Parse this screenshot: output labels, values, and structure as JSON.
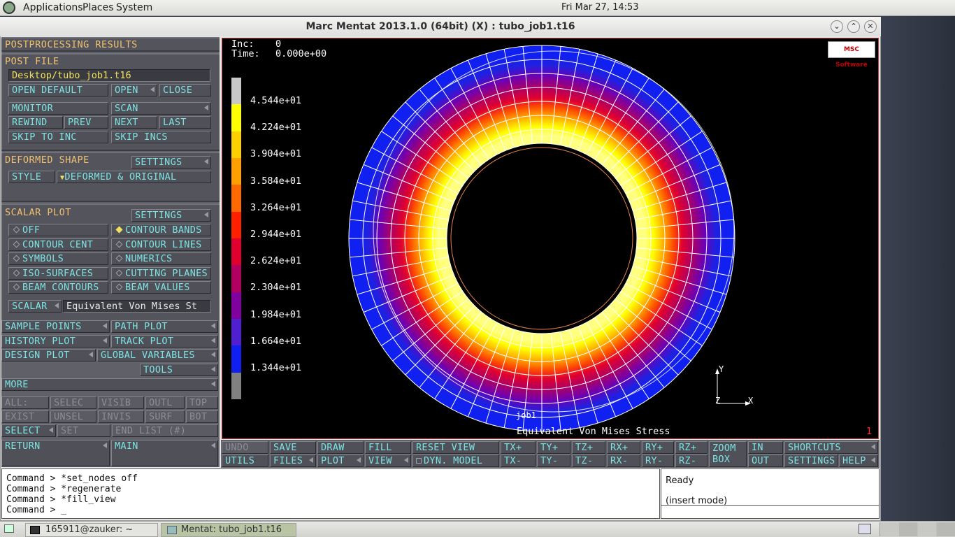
{
  "top_panel": {
    "menus": [
      "Applications",
      "Places",
      "System"
    ],
    "clock": "Fri Mar 27, 14:53"
  },
  "window": {
    "title": "Marc Mentat 2013.1.0 (64bit) (X) : tubo_job1.t16"
  },
  "left_panel": {
    "header": "POSTPROCESSING RESULTS",
    "post_file": {
      "label": "POST FILE",
      "path": "Desktop/tubo_job1.t16",
      "open_default": "OPEN DEFAULT",
      "open": "OPEN",
      "close": "CLOSE"
    },
    "nav": {
      "monitor": "MONITOR",
      "scan": "SCAN",
      "rewind": "REWIND",
      "prev": "PREV",
      "next": "NEXT",
      "last": "LAST",
      "skip_to_inc": "SKIP TO INC",
      "skip_incs": "SKIP INCS"
    },
    "deformed": {
      "label": "DEFORMED SHAPE",
      "settings": "SETTINGS",
      "style": "STYLE",
      "style_value": "DEFORMED & ORIGINAL"
    },
    "scalar": {
      "label": "SCALAR PLOT",
      "settings": "SETTINGS",
      "options": [
        "OFF",
        "CONTOUR BANDS",
        "CONTOUR CENT",
        "CONTOUR LINES",
        "SYMBOLS",
        "NUMERICS",
        "ISO-SURFACES",
        "CUTTING PLANES",
        "BEAM CONTOURS",
        "BEAM VALUES"
      ],
      "scalar_btn": "SCALAR",
      "scalar_value": "Equivalent Von Mises St"
    },
    "plots": {
      "sample_points": "SAMPLE POINTS",
      "path_plot": "PATH PLOT",
      "history_plot": "HISTORY PLOT",
      "track_plot": "TRACK PLOT",
      "design_plot": "DESIGN PLOT",
      "global_variables": "GLOBAL VARIABLES",
      "tools": "TOOLS",
      "more": "MORE"
    },
    "select_bar": {
      "all": "ALL:",
      "selec": "SELEC",
      "visib": "VISIB",
      "outl": "OUTL",
      "top": "TOP",
      "exist": "EXIST",
      "unsel": "UNSEL",
      "invis": "INVIS",
      "surf": "SURF",
      "bot": "BOT",
      "select": "SELECT",
      "set": "SET",
      "end_list": "END LIST (#)",
      "return": "RETURN",
      "main": "MAIN"
    }
  },
  "viewport": {
    "inc_label": "Inc:",
    "inc_value": "0",
    "time_label": "Time:",
    "time_value": "0.000e+00",
    "logo": "MSC Software",
    "legend": [
      "4.544e+01",
      "4.224e+01",
      "3.904e+01",
      "3.584e+01",
      "3.264e+01",
      "2.944e+01",
      "2.624e+01",
      "2.304e+01",
      "1.984e+01",
      "1.664e+01",
      "1.344e+01"
    ],
    "legend_colors": [
      "#c8c8c8",
      "#ffff00",
      "#ffd000",
      "#ffa000",
      "#ff6a00",
      "#ff2000",
      "#e00030",
      "#b00060",
      "#8000a0",
      "#5020d0",
      "#1020f0",
      "#808080"
    ],
    "job_label": "job1",
    "result_label": "Equivalent Von Mises Stress",
    "view_number": "1",
    "axes": {
      "x": "X",
      "y": "Y",
      "z": "Z"
    }
  },
  "toolbar": {
    "row1": [
      "UNDO",
      "SAVE",
      "DRAW",
      "FILL",
      "RESET VIEW",
      "TX+",
      "TY+",
      "TZ+",
      "RX+",
      "RY+",
      "RZ+",
      "IN",
      "SHORTCUTS"
    ],
    "row2": [
      "UTILS",
      "FILES",
      "PLOT",
      "VIEW",
      "DYN. MODEL",
      "TX-",
      "TY-",
      "TZ-",
      "RX-",
      "RY-",
      "RZ-",
      "OUT",
      "SETTINGS",
      "HELP"
    ],
    "zoom_box": [
      "ZOOM",
      "BOX"
    ]
  },
  "console": {
    "lines": [
      "Command > *set_nodes off",
      "Command > *regenerate",
      "Command > *fill_view",
      "Command > _"
    ]
  },
  "status": {
    "state": "Ready",
    "mode": "(insert mode)"
  },
  "taskbar": {
    "items": [
      "165911@zauker: ~",
      "Mentat: tubo_job1.t16"
    ]
  }
}
